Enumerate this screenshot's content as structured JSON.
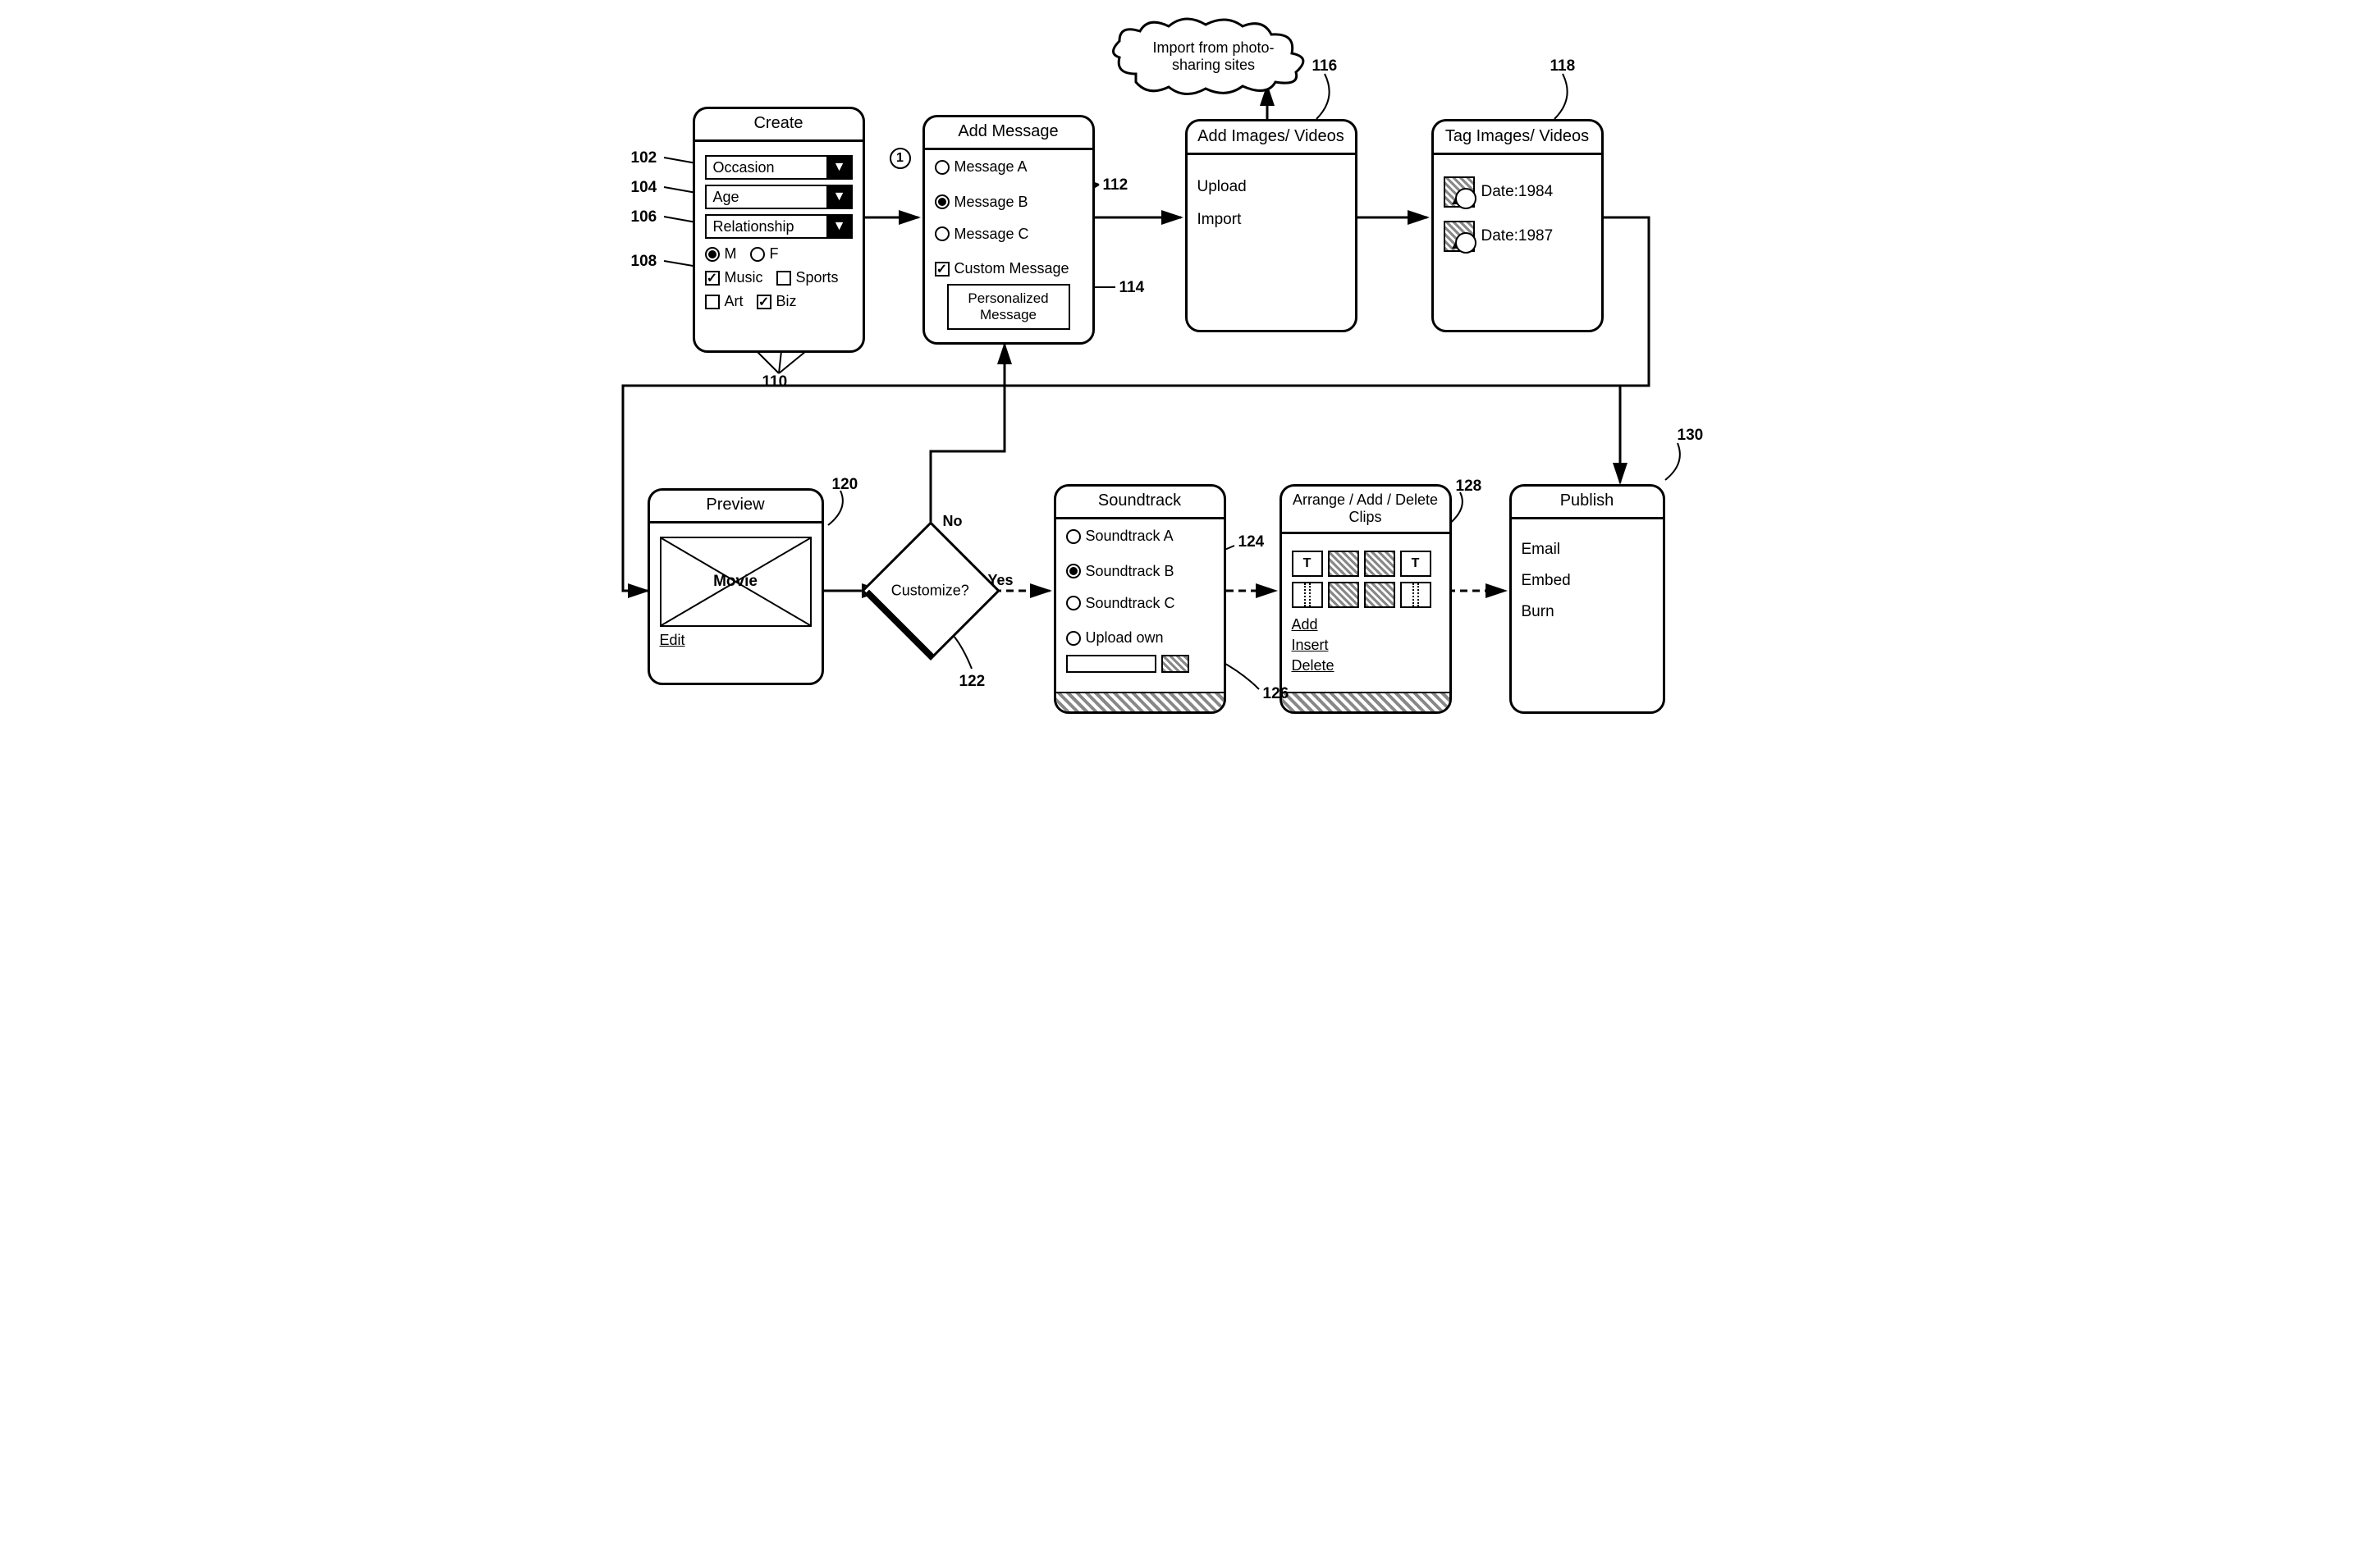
{
  "create": {
    "title": "Create",
    "occasion": "Occasion",
    "age": "Age",
    "relationship": "Relationship",
    "m": "M",
    "f": "F",
    "music": "Music",
    "sports": "Sports",
    "art": "Art",
    "biz": "Biz"
  },
  "addMessage": {
    "title": "Add Message",
    "a": "Message A",
    "b": "Message B",
    "c": "Message C",
    "custom": "Custom Message",
    "personalized": "Personalized Message"
  },
  "addImages": {
    "title": "Add Images/ Videos",
    "upload": "Upload",
    "import": "Import"
  },
  "tagImages": {
    "title": "Tag Images/ Videos",
    "d1": "Date:1984",
    "d2": "Date:1987"
  },
  "preview": {
    "title": "Preview",
    "movie": "Movie",
    "edit": "Edit"
  },
  "decision": {
    "label": "Customize?",
    "yes": "Yes",
    "no": "No"
  },
  "soundtrack": {
    "title": "Soundtrack",
    "a": "Soundtrack A",
    "b": "Soundtrack B",
    "c": "Soundtrack C",
    "upload": "Upload own"
  },
  "arrange": {
    "title": "Arrange / Add / Delete Clips",
    "add": "Add",
    "insert": "Insert",
    "del": "Delete"
  },
  "publish": {
    "title": "Publish",
    "email": "Email",
    "embed": "Embed",
    "burn": "Burn"
  },
  "cloud": "Import from photo-sharing sites",
  "refs": {
    "r102": "102",
    "r104": "104",
    "r106": "106",
    "r108": "108",
    "r110": "110",
    "r112": "112",
    "r114": "114",
    "r116": "116",
    "r118": "118",
    "r120": "120",
    "r122": "122",
    "r124": "124",
    "r126": "126",
    "r128": "128",
    "r130": "130",
    "one": "1"
  }
}
